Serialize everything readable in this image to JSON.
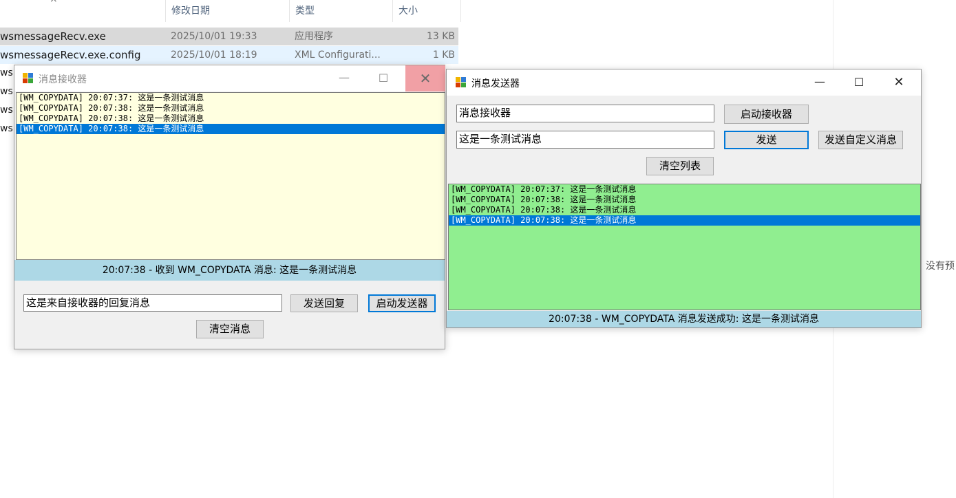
{
  "explorer": {
    "headers": {
      "name_icon": "×",
      "modified": "修改日期",
      "type": "类型",
      "size": "大小"
    },
    "files": [
      {
        "name": "wsmessageRecv.exe",
        "modified": "2025/10/01 19:33",
        "type": "应用程序",
        "size": "13 KB"
      },
      {
        "name": "wsmessageRecv.exe.config",
        "modified": "2025/10/01 18:19",
        "type": "XML Configurati...",
        "size": "1 KB"
      }
    ],
    "partial_rows": [
      "wsn",
      "wsn",
      "wsn",
      "wsn"
    ],
    "preview_text": "没有预"
  },
  "receiver": {
    "title": "消息接收器",
    "list_items": [
      "[WM_COPYDATA] 20:07:37: 这是一条测试消息",
      "[WM_COPYDATA] 20:07:38: 这是一条测试消息",
      "[WM_COPYDATA] 20:07:38: 这是一条测试消息",
      "[WM_COPYDATA] 20:07:38: 这是一条测试消息"
    ],
    "selected_index": 3,
    "status": "20:07:38 - 收到 WM_COPYDATA 消息: 这是一条测试消息",
    "reply_value": "这是来自接收器的回复消息",
    "send_reply_label": "发送回复",
    "start_sender_label": "启动发送器",
    "clear_label": "清空消息",
    "list_bg": "#ffffe0"
  },
  "sender": {
    "title": "消息发送器",
    "target_value": "消息接收器",
    "message_value": "这是一条测试消息",
    "start_receiver_label": "启动接收器",
    "send_label": "发送",
    "send_custom_label": "发送自定义消息",
    "clear_list_label": "清空列表",
    "list_items": [
      "[WM_COPYDATA] 20:07:37: 这是一条测试消息",
      "[WM_COPYDATA] 20:07:38: 这是一条测试消息",
      "[WM_COPYDATA] 20:07:38: 这是一条测试消息",
      "[WM_COPYDATA] 20:07:38: 这是一条测试消息"
    ],
    "selected_index": 3,
    "status": "20:07:38 - WM_COPYDATA 消息发送成功: 这是一条测试消息",
    "list_bg": "#90ee90"
  },
  "colors": {
    "selection": "#0078d7",
    "status_bg": "#add8e6",
    "close_hover": "#f1a0a5"
  },
  "icons": {
    "minimize": "minimize-icon",
    "maximize": "maximize-icon",
    "close": "close-icon",
    "app": "app-icon"
  }
}
